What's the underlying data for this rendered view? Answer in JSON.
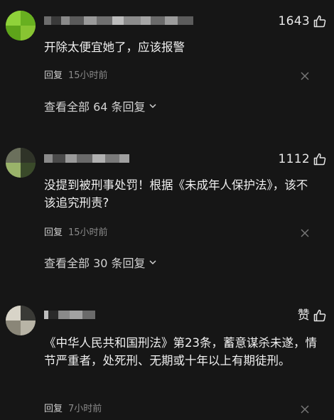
{
  "comments": [
    {
      "likes": "1643",
      "text": "开除太便宜她了，应该报警",
      "reply": "回复",
      "time": "15小时前",
      "view_all": "查看全部 64 条回复"
    },
    {
      "likes": "1112",
      "text": "没提到被刑事处罚！根据《未成年人保护法》，该不该追究刑责?",
      "reply": "回复",
      "time": "15小时前",
      "view_all": "查看全部 30 条回复"
    },
    {
      "likes": "赞",
      "text": "《中华人民共和国刑法》第23条，蓄意谋杀未遂，情节严重者，处死刑、无期或十年以上有期徒刑。",
      "reply": "回复",
      "time": "7小时前"
    }
  ],
  "colors": {
    "background": "#161616",
    "text": "#efefef",
    "muted": "#8a8a8a"
  },
  "icons": {
    "like": "thumbs-up-outline-icon",
    "close": "close-x-icon",
    "expand": "chevron-down-icon"
  }
}
